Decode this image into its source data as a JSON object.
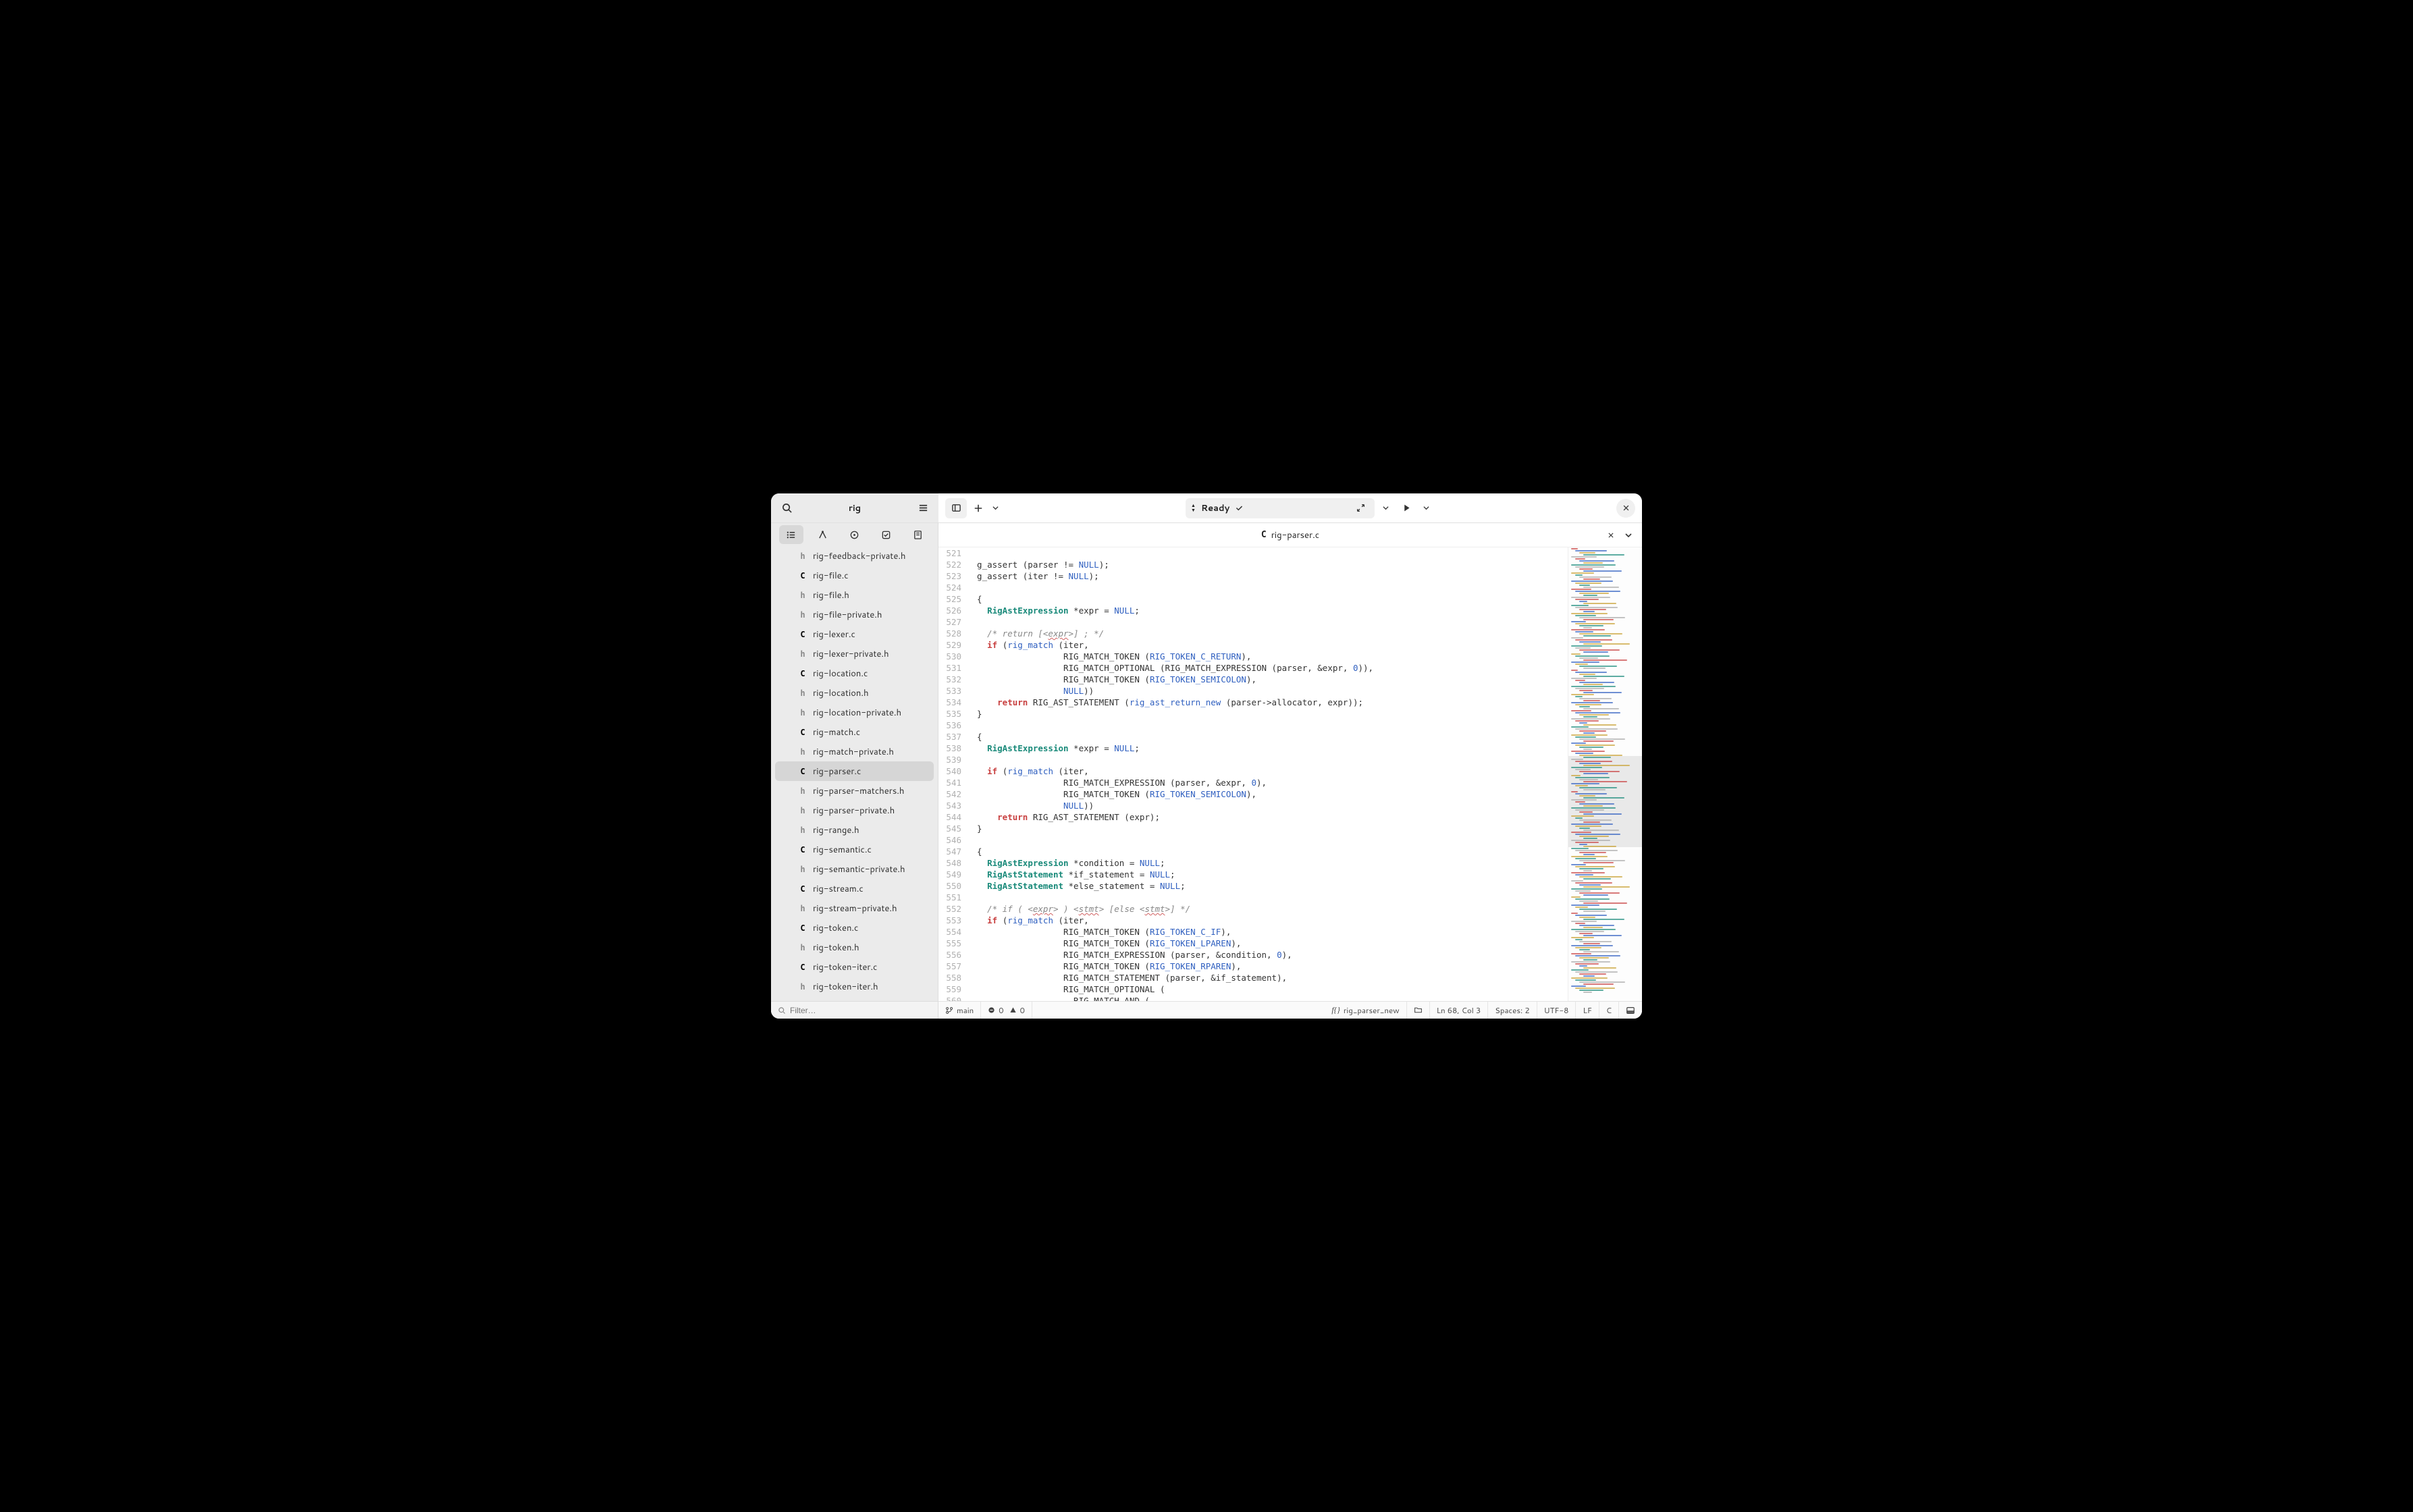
{
  "header": {
    "project_title": "rig",
    "ready_label": "Ready"
  },
  "tab": {
    "icon_letter": "C",
    "filename": "rig-parser.c"
  },
  "files": [
    {
      "icon": "h",
      "name": "rig-feedback-private.h",
      "selected": false
    },
    {
      "icon": "C",
      "name": "rig-file.c",
      "selected": false
    },
    {
      "icon": "h",
      "name": "rig-file.h",
      "selected": false
    },
    {
      "icon": "h",
      "name": "rig-file-private.h",
      "selected": false
    },
    {
      "icon": "C",
      "name": "rig-lexer.c",
      "selected": false
    },
    {
      "icon": "h",
      "name": "rig-lexer-private.h",
      "selected": false
    },
    {
      "icon": "C",
      "name": "rig-location.c",
      "selected": false
    },
    {
      "icon": "h",
      "name": "rig-location.h",
      "selected": false
    },
    {
      "icon": "h",
      "name": "rig-location-private.h",
      "selected": false
    },
    {
      "icon": "C",
      "name": "rig-match.c",
      "selected": false
    },
    {
      "icon": "h",
      "name": "rig-match-private.h",
      "selected": false
    },
    {
      "icon": "C",
      "name": "rig-parser.c",
      "selected": true
    },
    {
      "icon": "h",
      "name": "rig-parser-matchers.h",
      "selected": false
    },
    {
      "icon": "h",
      "name": "rig-parser-private.h",
      "selected": false
    },
    {
      "icon": "h",
      "name": "rig-range.h",
      "selected": false
    },
    {
      "icon": "C",
      "name": "rig-semantic.c",
      "selected": false
    },
    {
      "icon": "h",
      "name": "rig-semantic-private.h",
      "selected": false
    },
    {
      "icon": "C",
      "name": "rig-stream.c",
      "selected": false
    },
    {
      "icon": "h",
      "name": "rig-stream-private.h",
      "selected": false
    },
    {
      "icon": "C",
      "name": "rig-token.c",
      "selected": false
    },
    {
      "icon": "h",
      "name": "rig-token.h",
      "selected": false
    },
    {
      "icon": "C",
      "name": "rig-token-iter.c",
      "selected": false
    },
    {
      "icon": "h",
      "name": "rig-token-iter.h",
      "selected": false
    }
  ],
  "filter_placeholder": "Filter…",
  "code": {
    "first_line_no": 521,
    "lines": [
      [],
      [
        {
          "t": "  g_assert (parser != "
        },
        {
          "t": "NULL",
          "c": "const-null"
        },
        {
          "t": ");"
        }
      ],
      [
        {
          "t": "  g_assert (iter != "
        },
        {
          "t": "NULL",
          "c": "const-null"
        },
        {
          "t": ");"
        }
      ],
      [],
      [
        {
          "t": "  {"
        }
      ],
      [
        {
          "t": "    "
        },
        {
          "t": "RigAstExpression",
          "c": "kw-type"
        },
        {
          "t": " *expr = "
        },
        {
          "t": "NULL",
          "c": "const-null"
        },
        {
          "t": ";"
        }
      ],
      [],
      [
        {
          "t": "    "
        },
        {
          "t": "/* return [<",
          "c": "cmt"
        },
        {
          "t": "expr",
          "c": "cmt wavy"
        },
        {
          "t": ">] ; */",
          "c": "cmt"
        }
      ],
      [
        {
          "t": "    "
        },
        {
          "t": "if",
          "c": "kw"
        },
        {
          "t": " ("
        },
        {
          "t": "rig_match",
          "c": "fn"
        },
        {
          "t": " (iter,"
        }
      ],
      [
        {
          "t": "                   RIG_MATCH_TOKEN ("
        },
        {
          "t": "RIG_TOKEN_C_RETURN",
          "c": "const-enum"
        },
        {
          "t": "),"
        }
      ],
      [
        {
          "t": "                   RIG_MATCH_OPTIONAL (RIG_MATCH_EXPRESSION (parser, &expr, "
        },
        {
          "t": "0",
          "c": "num"
        },
        {
          "t": ")),"
        }
      ],
      [
        {
          "t": "                   RIG_MATCH_TOKEN ("
        },
        {
          "t": "RIG_TOKEN_SEMICOLON",
          "c": "const-enum"
        },
        {
          "t": "),"
        }
      ],
      [
        {
          "t": "                   "
        },
        {
          "t": "NULL",
          "c": "const-null"
        },
        {
          "t": "))"
        }
      ],
      [
        {
          "t": "      "
        },
        {
          "t": "return",
          "c": "kw"
        },
        {
          "t": " RIG_AST_STATEMENT ("
        },
        {
          "t": "rig_ast_return_new",
          "c": "fn"
        },
        {
          "t": " (parser->allocator, expr));"
        }
      ],
      [
        {
          "t": "  }"
        }
      ],
      [],
      [
        {
          "t": "  {"
        }
      ],
      [
        {
          "t": "    "
        },
        {
          "t": "RigAstExpression",
          "c": "kw-type"
        },
        {
          "t": " *expr = "
        },
        {
          "t": "NULL",
          "c": "const-null"
        },
        {
          "t": ";"
        }
      ],
      [],
      [
        {
          "t": "    "
        },
        {
          "t": "if",
          "c": "kw"
        },
        {
          "t": " ("
        },
        {
          "t": "rig_match",
          "c": "fn"
        },
        {
          "t": " (iter,"
        }
      ],
      [
        {
          "t": "                   RIG_MATCH_EXPRESSION (parser, &expr, "
        },
        {
          "t": "0",
          "c": "num"
        },
        {
          "t": "),"
        }
      ],
      [
        {
          "t": "                   RIG_MATCH_TOKEN ("
        },
        {
          "t": "RIG_TOKEN_SEMICOLON",
          "c": "const-enum"
        },
        {
          "t": "),"
        }
      ],
      [
        {
          "t": "                   "
        },
        {
          "t": "NULL",
          "c": "const-null"
        },
        {
          "t": "))"
        }
      ],
      [
        {
          "t": "      "
        },
        {
          "t": "return",
          "c": "kw"
        },
        {
          "t": " RIG_AST_STATEMENT (expr);"
        }
      ],
      [
        {
          "t": "  }"
        }
      ],
      [],
      [
        {
          "t": "  {"
        }
      ],
      [
        {
          "t": "    "
        },
        {
          "t": "RigAstExpression",
          "c": "kw-type"
        },
        {
          "t": " *condition = "
        },
        {
          "t": "NULL",
          "c": "const-null"
        },
        {
          "t": ";"
        }
      ],
      [
        {
          "t": "    "
        },
        {
          "t": "RigAstStatement",
          "c": "kw-type"
        },
        {
          "t": " *if_statement = "
        },
        {
          "t": "NULL",
          "c": "const-null"
        },
        {
          "t": ";"
        }
      ],
      [
        {
          "t": "    "
        },
        {
          "t": "RigAstStatement",
          "c": "kw-type"
        },
        {
          "t": " *else_statement = "
        },
        {
          "t": "NULL",
          "c": "const-null"
        },
        {
          "t": ";"
        }
      ],
      [],
      [
        {
          "t": "    "
        },
        {
          "t": "/* if ( <",
          "c": "cmt"
        },
        {
          "t": "expr",
          "c": "cmt wavy"
        },
        {
          "t": "> ) <",
          "c": "cmt"
        },
        {
          "t": "stmt",
          "c": "cmt wavy"
        },
        {
          "t": "> [else <",
          "c": "cmt"
        },
        {
          "t": "stmt",
          "c": "cmt wavy"
        },
        {
          "t": ">] */",
          "c": "cmt"
        }
      ],
      [
        {
          "t": "    "
        },
        {
          "t": "if",
          "c": "kw"
        },
        {
          "t": " ("
        },
        {
          "t": "rig_match",
          "c": "fn"
        },
        {
          "t": " (iter,"
        }
      ],
      [
        {
          "t": "                   RIG_MATCH_TOKEN ("
        },
        {
          "t": "RIG_TOKEN_C_IF",
          "c": "const-enum"
        },
        {
          "t": "),"
        }
      ],
      [
        {
          "t": "                   RIG_MATCH_TOKEN ("
        },
        {
          "t": "RIG_TOKEN_LPAREN",
          "c": "const-enum"
        },
        {
          "t": "),"
        }
      ],
      [
        {
          "t": "                   RIG_MATCH_EXPRESSION (parser, &condition, "
        },
        {
          "t": "0",
          "c": "num"
        },
        {
          "t": "),"
        }
      ],
      [
        {
          "t": "                   RIG_MATCH_TOKEN ("
        },
        {
          "t": "RIG_TOKEN_RPAREN",
          "c": "const-enum"
        },
        {
          "t": "),"
        }
      ],
      [
        {
          "t": "                   RIG_MATCH_STATEMENT (parser, &if_statement),"
        }
      ],
      [
        {
          "t": "                   RIG_MATCH_OPTIONAL ("
        }
      ],
      [
        {
          "t": "                     RIG_MATCH_AND ("
        }
      ]
    ]
  },
  "status": {
    "branch": "main",
    "errors": "0",
    "warnings": "0",
    "symbol": "rig_parser_new",
    "position": "Ln 68, Col 3",
    "spaces": "Spaces: 2",
    "encoding": "UTF-8",
    "line_ending": "LF",
    "lang": "C"
  }
}
